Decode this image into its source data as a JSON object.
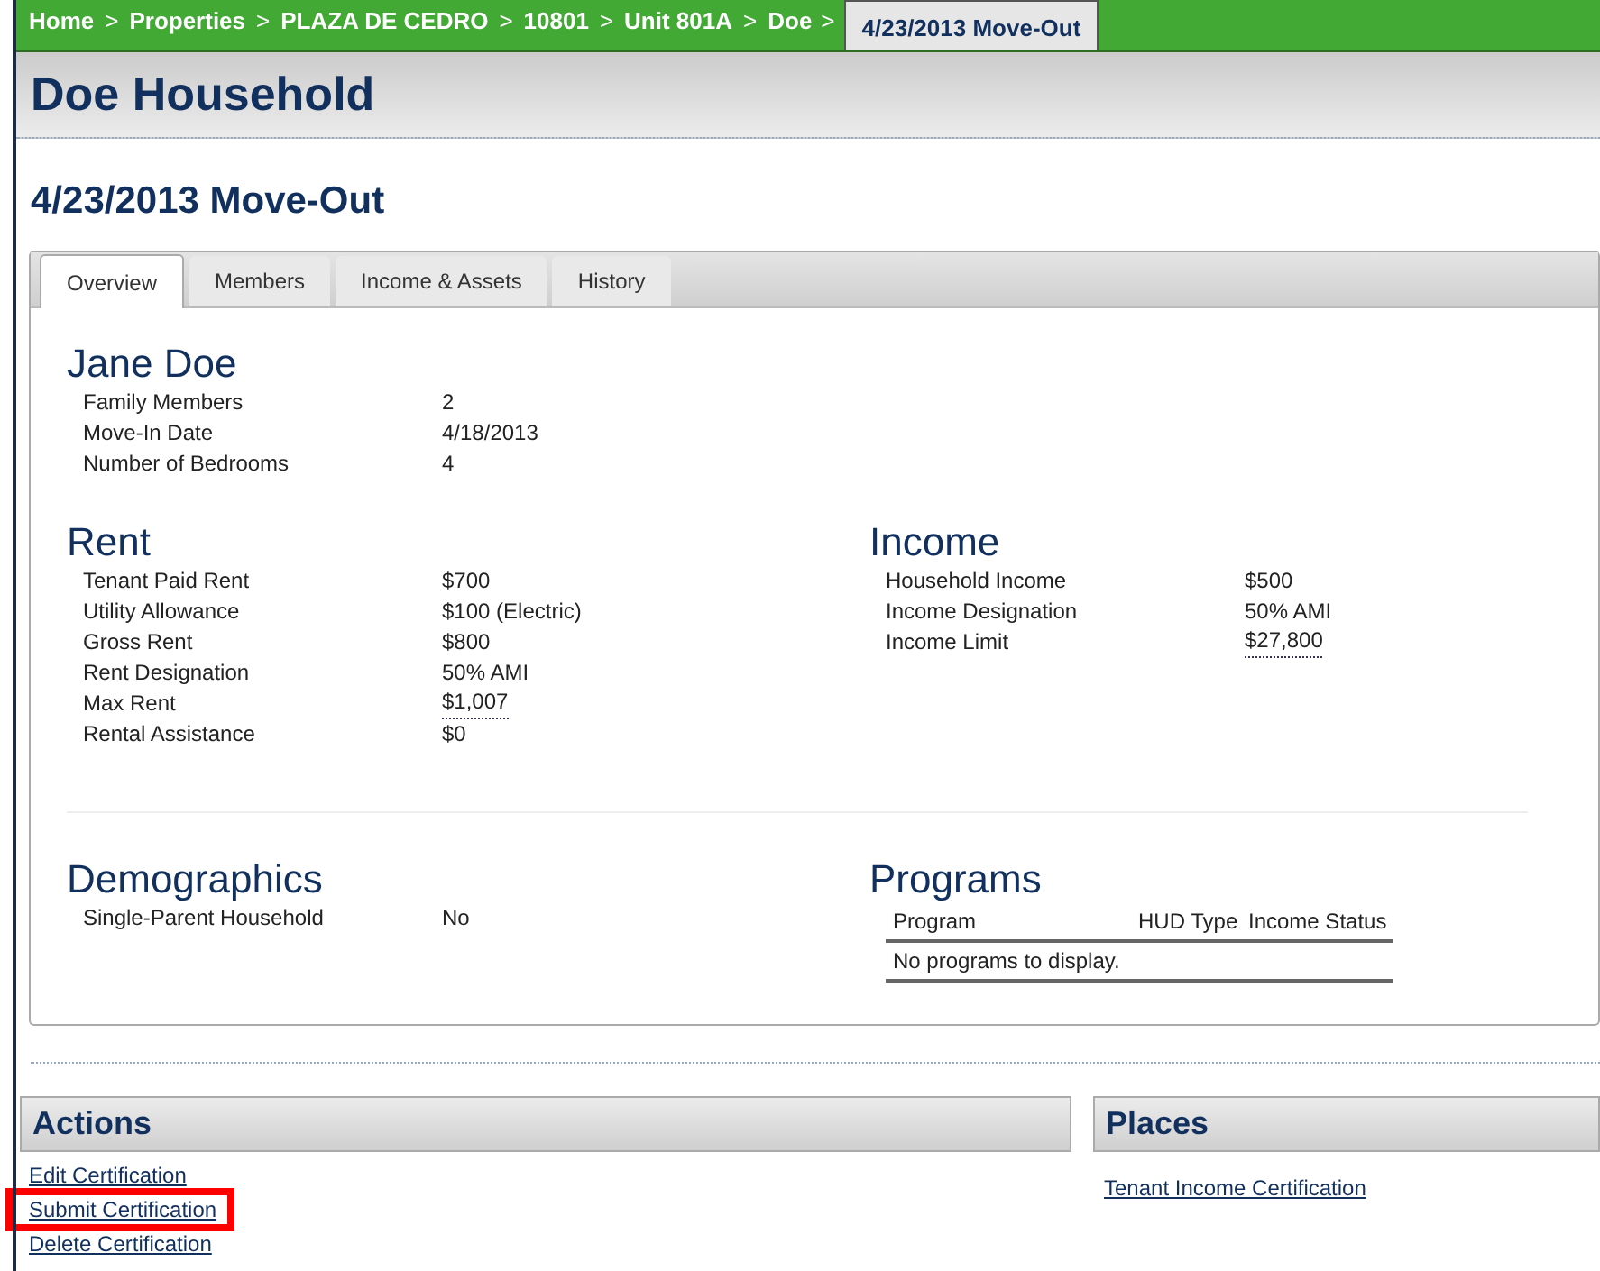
{
  "breadcrumb": [
    {
      "label": "Home",
      "selected": false
    },
    {
      "label": "Properties",
      "selected": false
    },
    {
      "label": "PLAZA DE CEDRO",
      "selected": false
    },
    {
      "label": "10801",
      "selected": false
    },
    {
      "label": "Unit 801A",
      "selected": false
    },
    {
      "label": "Doe",
      "selected": false
    },
    {
      "label": "4/23/2013 Move-Out",
      "selected": true
    }
  ],
  "separator": ">",
  "household_title": "Doe Household",
  "page_title": "4/23/2013 Move-Out",
  "tabs": [
    {
      "label": "Overview",
      "selected": true
    },
    {
      "label": "Members",
      "selected": false
    },
    {
      "label": "Income & Assets",
      "selected": false
    },
    {
      "label": "History",
      "selected": false
    }
  ],
  "person": {
    "title": "Jane Doe",
    "fields": [
      {
        "label": "Family Members",
        "value": "2",
        "kind": "plain"
      },
      {
        "label": "Move-In Date",
        "value": "4/18/2013",
        "kind": "plain"
      },
      {
        "label": "Number of Bedrooms",
        "value": "4",
        "kind": "plain"
      }
    ]
  },
  "rent": {
    "title": "Rent",
    "fields": [
      {
        "label": "Tenant Paid Rent",
        "value": "$700",
        "kind": "plain"
      },
      {
        "label": "Utility Allowance",
        "value": "$100 (Electric)",
        "kind": "plain"
      },
      {
        "label": "Gross Rent",
        "value": "$800",
        "kind": "plain"
      },
      {
        "label": "Rent Designation",
        "value": "50% AMI",
        "kind": "plain"
      },
      {
        "label": "Max Rent",
        "value": "$1,007",
        "kind": "hint"
      },
      {
        "label": "Rental Assistance",
        "value": "$0",
        "kind": "plain"
      }
    ]
  },
  "income": {
    "title": "Income",
    "fields": [
      {
        "label": "Household Income",
        "value": "$500",
        "kind": "plain"
      },
      {
        "label": "Income Designation",
        "value": "50% AMI",
        "kind": "plain"
      },
      {
        "label": "Income Limit",
        "value": "$27,800",
        "kind": "hint"
      }
    ]
  },
  "demographics": {
    "title": "Demographics",
    "fields": [
      {
        "label": "Single-Parent Household",
        "value": "No",
        "kind": "plain"
      }
    ]
  },
  "programs": {
    "title": "Programs",
    "columns": [
      "Program",
      "HUD Type",
      "Income Status"
    ],
    "empty_message": "No programs to display."
  },
  "actions": {
    "title": "Actions",
    "links": [
      {
        "label": "Edit Certification",
        "highlighted": false
      },
      {
        "label": "Submit Certification",
        "highlighted": true
      },
      {
        "label": "Delete Certification",
        "highlighted": false
      }
    ]
  },
  "places": {
    "title": "Places",
    "links": [
      {
        "label": "Tenant Income Certification"
      }
    ]
  }
}
